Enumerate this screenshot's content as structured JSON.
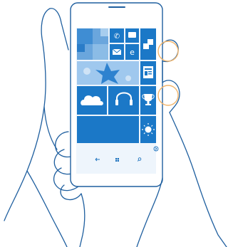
{
  "device": {
    "screen_color": "#1b78c7",
    "body_color": "#ffffff",
    "outline_color": "#1f5f9f",
    "highlight_color": "#f2b56b"
  },
  "tiles": [
    {
      "name": "photos-tile",
      "icon": "photo-mosaic-icon"
    },
    {
      "name": "phone-tile",
      "icon": "phone-icon"
    },
    {
      "name": "messaging-tile",
      "icon": "chat-bubble-icon"
    },
    {
      "name": "email-tile",
      "icon": "envelope-icon"
    },
    {
      "name": "internet-explorer-tile",
      "icon": "ie-logo-icon"
    },
    {
      "name": "store-tile",
      "icon": "store-bag-icon"
    },
    {
      "name": "people-tile",
      "icon": "people-flower-icon"
    },
    {
      "name": "news-tile",
      "icon": "newspaper-icon"
    },
    {
      "name": "onedrive-tile",
      "icon": "cloud-icon"
    },
    {
      "name": "music-tile",
      "icon": "headphones-icon"
    },
    {
      "name": "games-tile",
      "icon": "trophy-icon"
    },
    {
      "name": "wide-tile",
      "icon": ""
    },
    {
      "name": "weather-tile",
      "icon": "sun-icon"
    }
  ],
  "navbar": {
    "back": "back-arrow-icon",
    "start": "windows-logo-icon",
    "search": "search-icon",
    "more": "more-arrow-icon"
  },
  "highlights": [
    "volume-key-highlight",
    "power-key-highlight"
  ]
}
